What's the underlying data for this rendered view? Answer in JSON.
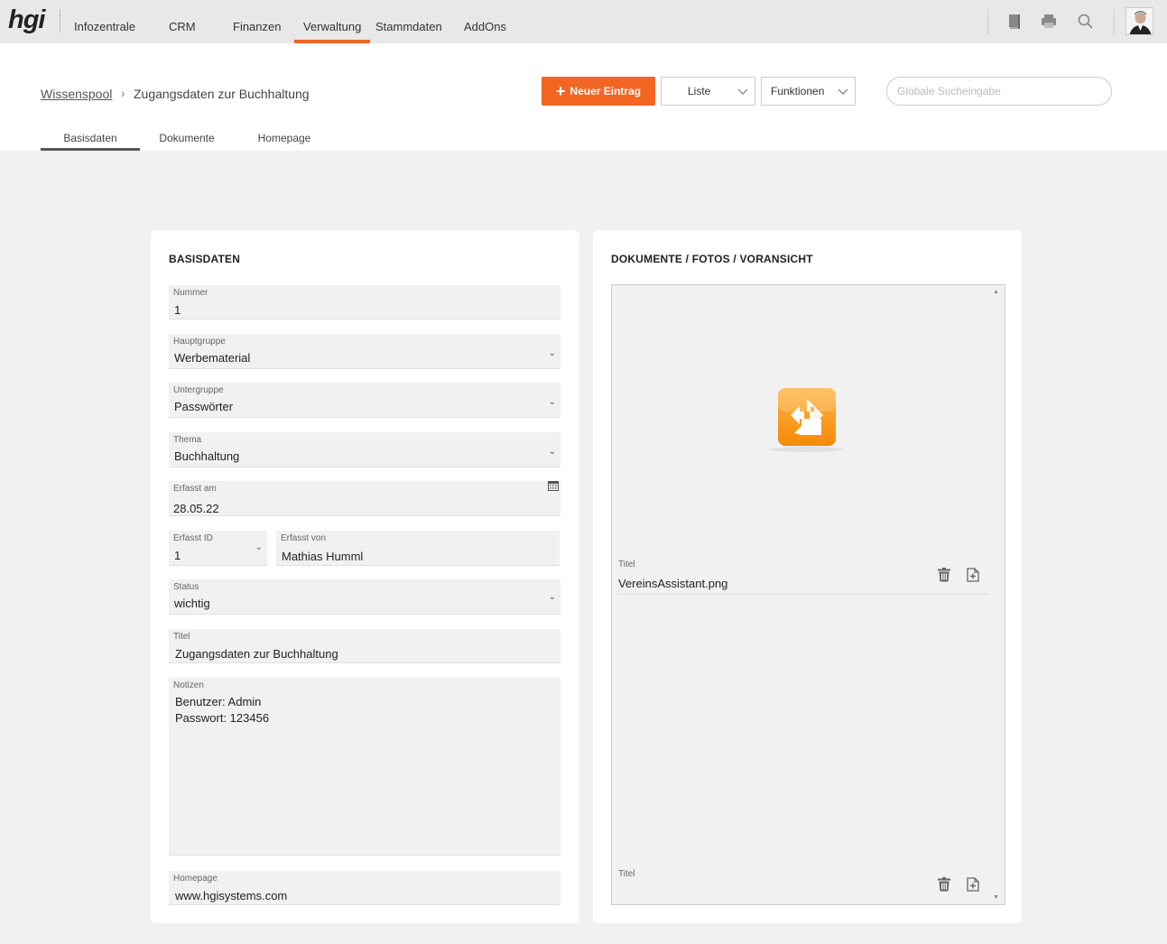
{
  "app": {
    "logo": "hgi",
    "nav": [
      "Infozentrale",
      "CRM",
      "Finanzen",
      "Verwaltung",
      "Stammdaten",
      "AddOns"
    ],
    "nav_active": "Verwaltung",
    "icons": [
      "book-icon",
      "printer-icon",
      "search-icon"
    ],
    "accent_color": "#f26522"
  },
  "breadcrumb": {
    "parent": "Wissenspool",
    "separator": "›",
    "current": "Zugangsdaten zur Buchhaltung"
  },
  "toolbar": {
    "new_label": "Neuer Eintrag",
    "list_label": "Liste",
    "functions_label": "Funktionen",
    "search_placeholder": "Globale Sucheingabe"
  },
  "tabs": [
    "Basisdaten",
    "Dokumente",
    "Homepage"
  ],
  "active_tab": "Basisdaten",
  "basisdaten": {
    "title": "BASISDATEN",
    "nummer": {
      "label": "Nummer",
      "value": "1"
    },
    "hauptgruppe": {
      "label": "Hauptgruppe",
      "value": "Werbematerial"
    },
    "untergruppe": {
      "label": "Untergruppe",
      "value": "Passwörter"
    },
    "thema": {
      "label": "Thema",
      "value": "Buchhaltung"
    },
    "erfasst_am": {
      "label": "Erfasst am",
      "value": "28.05.22"
    },
    "erfasst_id": {
      "label": "Erfasst ID",
      "value": "1"
    },
    "erfasst_von": {
      "label": "Erfasst von",
      "value": "Mathias Humml"
    },
    "status": {
      "label": "Status",
      "value": "wichtig"
    },
    "titel": {
      "label": "Titel",
      "value": "Zugangsdaten zur Buchhaltung"
    },
    "notizen": {
      "label": "Notizen",
      "value": "Benutzer: Admin\nPasswort: 123456"
    },
    "homepage": {
      "label": "Homepage",
      "value": "www.hgisystems.com"
    }
  },
  "dokumente": {
    "title": "DOKUMENTE / FOTOS / VORANSICHT",
    "items": [
      {
        "label": "Titel",
        "value": "VereinsAssistant.png"
      },
      {
        "label": "Titel",
        "value": ""
      }
    ]
  }
}
